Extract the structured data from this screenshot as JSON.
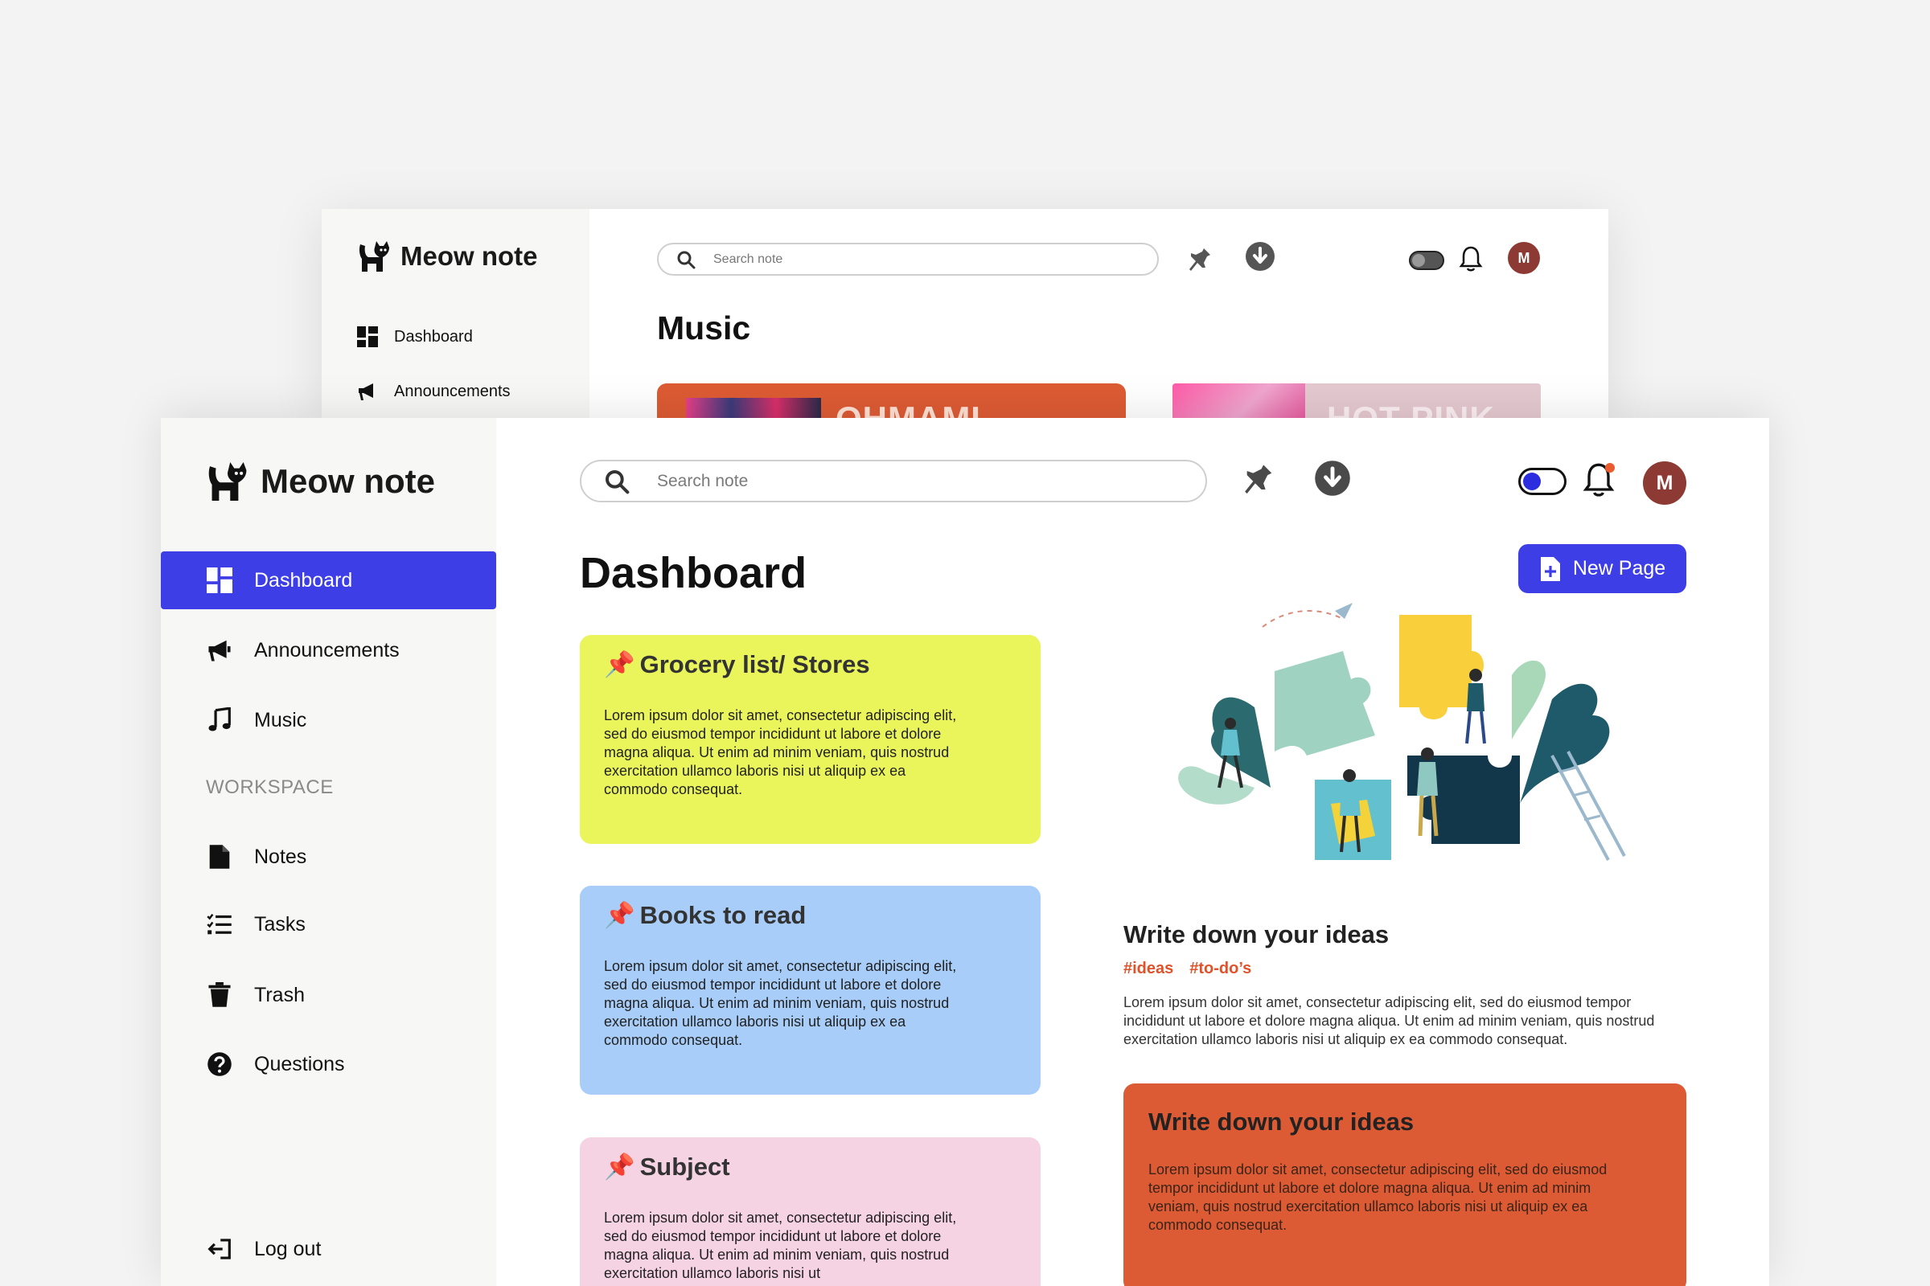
{
  "back_window": {
    "app_name": "Meow note",
    "nav": [
      "Dashboard",
      "Announcements"
    ],
    "search_placeholder": "Search note",
    "page_title": "Music",
    "cards": [
      "OHMAMI",
      "HOT PINK"
    ]
  },
  "app": {
    "name": "Meow note"
  },
  "sidebar": {
    "items": [
      {
        "label": "Dashboard",
        "icon": "dashboard-icon"
      },
      {
        "label": "Announcements",
        "icon": "megaphone-icon"
      },
      {
        "label": "Music",
        "icon": "music-note-icon"
      }
    ],
    "section_label": "WORKSPACE",
    "workspace_items": [
      {
        "label": "Notes",
        "icon": "document-icon"
      },
      {
        "label": "Tasks",
        "icon": "checklist-icon"
      },
      {
        "label": "Trash",
        "icon": "trash-icon"
      },
      {
        "label": "Questions",
        "icon": "question-icon"
      }
    ],
    "logout_label": "Log out"
  },
  "header": {
    "search_placeholder": "Search note",
    "avatar_initial": "M"
  },
  "main": {
    "title": "Dashboard",
    "new_page_label": "New Page",
    "notes": [
      {
        "title": "Grocery list/ Stores",
        "color": "#e9f55a",
        "body": "Lorem ipsum dolor sit amet, consectetur adipiscing elit, sed do eiusmod tempor incididunt ut labore et dolore magna aliqua. Ut enim ad minim veniam, quis nostrud exercitation ullamco laboris nisi ut aliquip ex ea commodo consequat."
      },
      {
        "title": "Books to read",
        "color": "#a7cdf8",
        "body": "Lorem ipsum dolor sit amet, consectetur adipiscing elit, sed do eiusmod tempor incididunt ut labore et dolore magna aliqua. Ut enim ad minim veniam, quis nostrud exercitation ullamco laboris nisi ut aliquip ex ea commodo consequat."
      },
      {
        "title": "Subject",
        "color": "#f6d3e2",
        "body": "Lorem ipsum dolor sit amet, consectetur adipiscing elit, sed do eiusmod tempor incididunt ut labore et dolore magna aliqua. Ut enim ad minim veniam, quis nostrud exercitation ullamco laboris nisi ut"
      }
    ],
    "idea": {
      "title": "Write down your ideas",
      "tags": [
        "#ideas",
        "#to-do’s"
      ],
      "body": "Lorem ipsum dolor sit amet, consectetur adipiscing elit, sed do eiusmod tempor incididunt ut labore et dolore magna aliqua. Ut enim ad minim veniam, quis nostrud exercitation ullamco laboris nisi ut aliquip ex ea commodo consequat."
    },
    "orange_card": {
      "title": "Write down your ideas",
      "body": "Lorem ipsum dolor sit amet, consectetur adipiscing elit, sed do eiusmod tempor incididunt ut labore et dolore magna aliqua. Ut enim ad minim veniam, quis nostrud exercitation ullamco laboris nisi ut aliquip ex ea commodo consequat."
    }
  },
  "colors": {
    "accent": "#3d3ee6",
    "orange": "#dd5b34",
    "tag": "#e0522a",
    "avatar": "#8e3a34"
  }
}
